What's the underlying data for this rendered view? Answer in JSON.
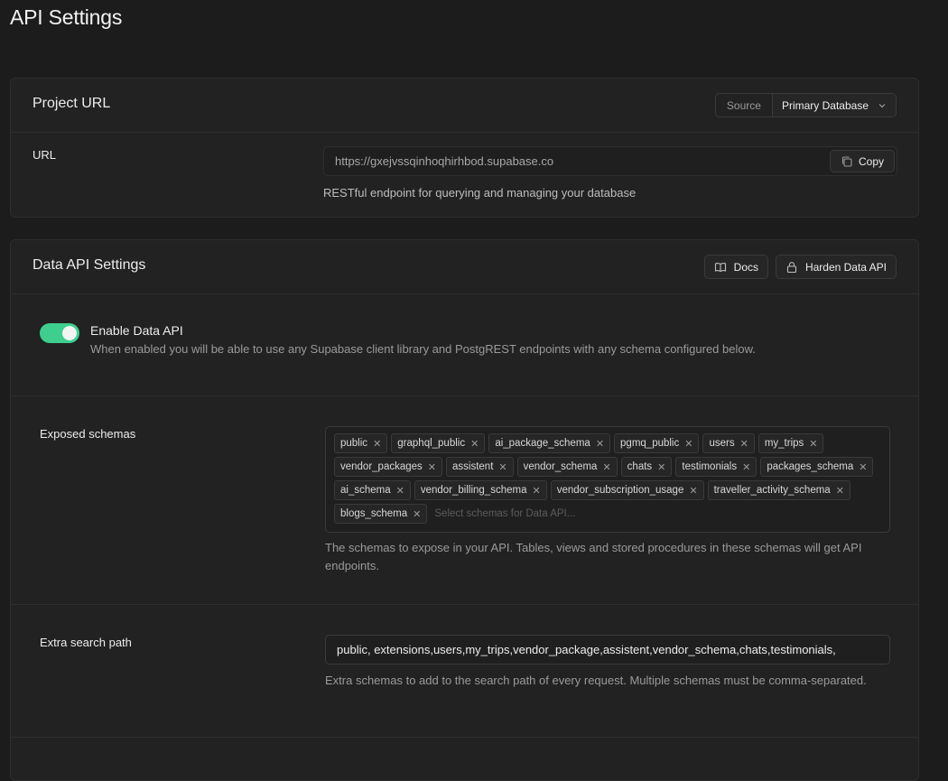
{
  "page": {
    "title": "API Settings"
  },
  "project_url": {
    "title": "Project URL",
    "source_label": "Source",
    "source_value": "Primary Database",
    "url_label": "URL",
    "url_value": "https://gxejvssqinhoqhirhbod.supabase.co",
    "copy_label": "Copy",
    "description": "RESTful endpoint for querying and managing your database"
  },
  "data_api": {
    "title": "Data API Settings",
    "docs_label": "Docs",
    "harden_label": "Harden Data API",
    "enable": {
      "title": "Enable Data API",
      "description": "When enabled you will be able to use any Supabase client library and PostgREST endpoints with any schema configured below.",
      "enabled": true,
      "accent": "#3ecf8e"
    },
    "exposed": {
      "label": "Exposed schemas",
      "schemas": [
        "public",
        "graphql_public",
        "ai_package_schema",
        "pgmq_public",
        "users",
        "my_trips",
        "vendor_packages",
        "assistent",
        "vendor_schema",
        "chats",
        "testimonials",
        "packages_schema",
        "ai_schema",
        "vendor_billing_schema",
        "vendor_subscription_usage",
        "traveller_activity_schema",
        "blogs_schema"
      ],
      "placeholder": "Select schemas for Data API...",
      "description": "The schemas to expose in your API. Tables, views and stored procedures in these schemas will get API endpoints."
    },
    "extra_search_path": {
      "label": "Extra search path",
      "value": "public, extensions,users,my_trips,vendor_package,assistent,vendor_schema,chats,testimonials,",
      "description": "Extra schemas to add to the search path of every request. Multiple schemas must be comma-separated."
    }
  }
}
